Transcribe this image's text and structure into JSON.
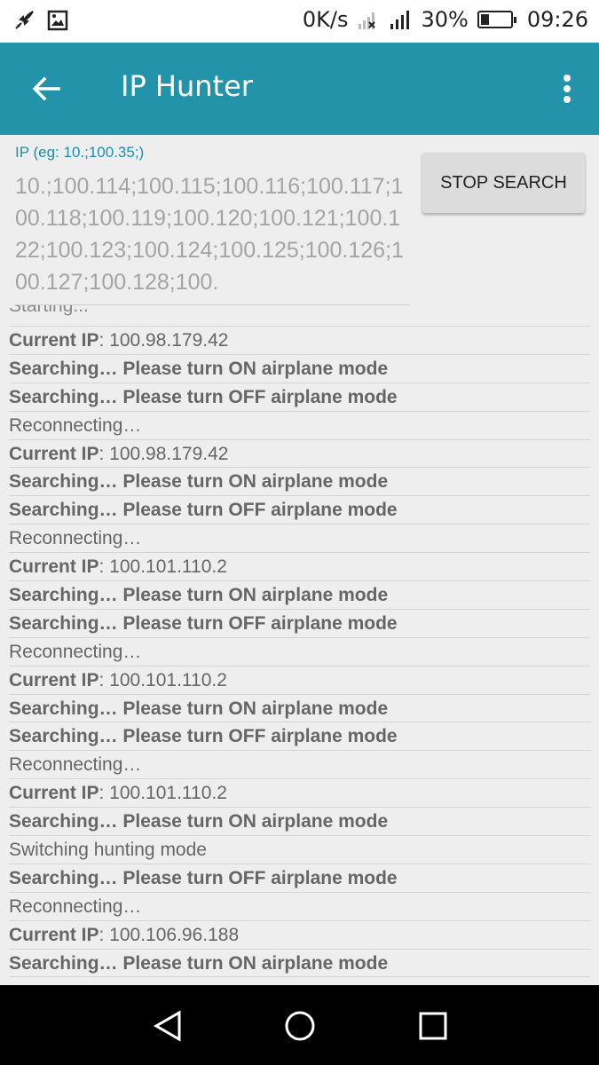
{
  "status_bar": {
    "speed": "0K/s",
    "battery": "30%",
    "battery_level": 0.3,
    "time": "09:26"
  },
  "app_bar": {
    "title": "IP Hunter"
  },
  "ip_field": {
    "label": "IP (eg: 10.;100.35;)",
    "value": "10.;100.114;100.115;100.116;100.117;100.118;100.119;100.120;100.121;100.122;100.123;100.124;100.125;100.126;100.127;100.128;100."
  },
  "stop_button": {
    "label": "STOP SEARCH"
  },
  "log": {
    "partial_top": "Starting...",
    "rows": [
      {
        "key": "Current IP",
        "value": ": 100.98.179.42"
      },
      {
        "text": "Searching… Please turn ON airplane mode",
        "bold": true
      },
      {
        "text": "Searching… Please turn OFF airplane mode",
        "bold": true
      },
      {
        "text": "Reconnecting…",
        "bold": false
      },
      {
        "key": "Current IP",
        "value": ": 100.98.179.42"
      },
      {
        "text": "Searching… Please turn ON airplane mode",
        "bold": true
      },
      {
        "text": "Searching… Please turn OFF airplane mode",
        "bold": true
      },
      {
        "text": "Reconnecting…",
        "bold": false
      },
      {
        "key": "Current IP",
        "value": ": 100.101.110.2"
      },
      {
        "text": "Searching… Please turn ON airplane mode",
        "bold": true
      },
      {
        "text": "Searching… Please turn OFF airplane mode",
        "bold": true
      },
      {
        "text": "Reconnecting…",
        "bold": false
      },
      {
        "key": "Current IP",
        "value": ": 100.101.110.2"
      },
      {
        "text": "Searching… Please turn ON airplane mode",
        "bold": true
      },
      {
        "text": "Searching… Please turn OFF airplane mode",
        "bold": true
      },
      {
        "text": "Reconnecting…",
        "bold": false
      },
      {
        "key": "Current IP",
        "value": ": 100.101.110.2"
      },
      {
        "text": "Searching… Please turn ON airplane mode",
        "bold": true
      },
      {
        "text": "Switching hunting mode",
        "bold": false
      },
      {
        "text": "Searching… Please turn OFF airplane mode",
        "bold": true
      },
      {
        "text": "Reconnecting…",
        "bold": false
      },
      {
        "key": "Current IP",
        "value": ": 100.106.96.188"
      },
      {
        "text": "Searching… Please turn ON airplane mode",
        "bold": true
      }
    ]
  },
  "colors": {
    "app_bar": "#2293a9",
    "accent": "#1e8fa5",
    "background": "#eeeeee"
  }
}
